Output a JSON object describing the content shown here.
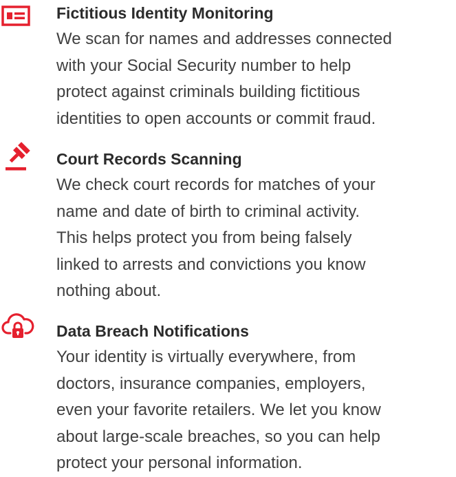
{
  "accent_color": "#e5202e",
  "features": [
    {
      "icon": "id-card-icon",
      "title": "Fictitious Identity Monitoring",
      "lines": [
        "We scan for names and addresses connected",
        "with your Social Security number to help",
        "protect against criminals building fictitious",
        "identities to open accounts or commit fraud."
      ]
    },
    {
      "icon": "gavel-icon",
      "title": "Court Records Scanning",
      "lines": [
        "We check court records for matches of your",
        "name and date of birth to criminal activity.",
        "This helps protect you from being falsely",
        "linked to arrests and convictions you know",
        "nothing about."
      ]
    },
    {
      "icon": "cloud-lock-icon",
      "title": "Data Breach Notifications",
      "lines": [
        "Your identity is virtually everywhere, from",
        "doctors, insurance companies, employers,",
        "even your favorite retailers. We let you know",
        "about large-scale breaches, so you can help",
        "protect your personal information."
      ]
    }
  ]
}
